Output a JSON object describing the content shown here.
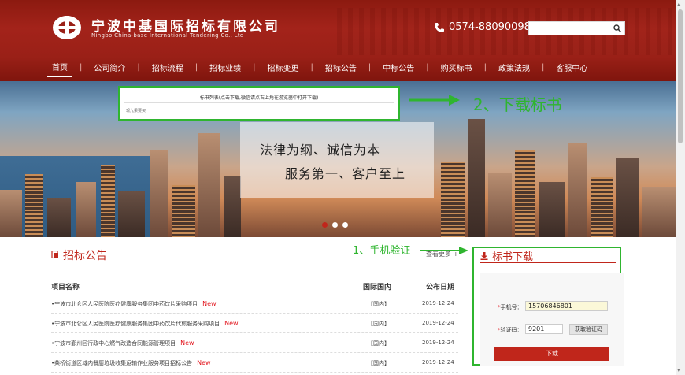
{
  "header": {
    "logo_cn": "宁波中基国际招标有限公司",
    "logo_en": "Ningbo China-base International Tendering Co., Ltd",
    "phone": "0574-88090098",
    "search_placeholder": ""
  },
  "nav": {
    "items": [
      {
        "label": "首页",
        "active": true
      },
      {
        "label": "公司简介"
      },
      {
        "label": "招标流程"
      },
      {
        "label": "招标业绩"
      },
      {
        "label": "招标变更"
      },
      {
        "label": "招标公告"
      },
      {
        "label": "中标公告"
      },
      {
        "label": "购买标书"
      },
      {
        "label": "政策法规"
      },
      {
        "label": "客服中心"
      }
    ]
  },
  "banner": {
    "slogan_line1": "法律为纲、诚信为本",
    "slogan_line2": "服务第一、客户至上",
    "download_panel": {
      "title": "标书列表(点击下载,微信请点右上角在游览器中打开下载)",
      "item": "现九果要买"
    },
    "annotation_step2": "2、下载标书",
    "slide_count": 3,
    "active_slide": 1
  },
  "notices": {
    "title": "招标公告",
    "more": "查看更多 +",
    "annotation_step1": "1、手机验证",
    "columns": {
      "name": "项目名称",
      "region": "国际国内",
      "date": "公布日期"
    },
    "rows": [
      {
        "title": "宁波市北仑区人民医院医疗健康服务集团中药饮片采购项目",
        "new": "New",
        "region": "【国内】",
        "date": "2019-12-24"
      },
      {
        "title": "宁波市北仑区人民医院医疗健康服务集团中药饮片代煎服务采购项目",
        "new": "New",
        "region": "【国内】",
        "date": "2019-12-24"
      },
      {
        "title": "宁波市鄞州区行政中心燃气改造合同能源管理项目",
        "new": "New",
        "region": "【国内】",
        "date": "2019-12-24"
      },
      {
        "title": "柴桥街道区域内餐厨垃圾收集运输作业服务项目招标公告",
        "new": "New",
        "region": "【国内】",
        "date": "2019-12-24"
      }
    ]
  },
  "sidebar": {
    "title": "标书下载",
    "phone_label": "手机号：",
    "phone_value": "15706846801",
    "code_label": "验证码：",
    "code_value": "9201",
    "get_code_button": "获取验证码",
    "download_button": "下载"
  },
  "colors": {
    "brand_red": "#c0261b",
    "annotation_green": "#2fb52f",
    "new_red": "#e2141c"
  }
}
